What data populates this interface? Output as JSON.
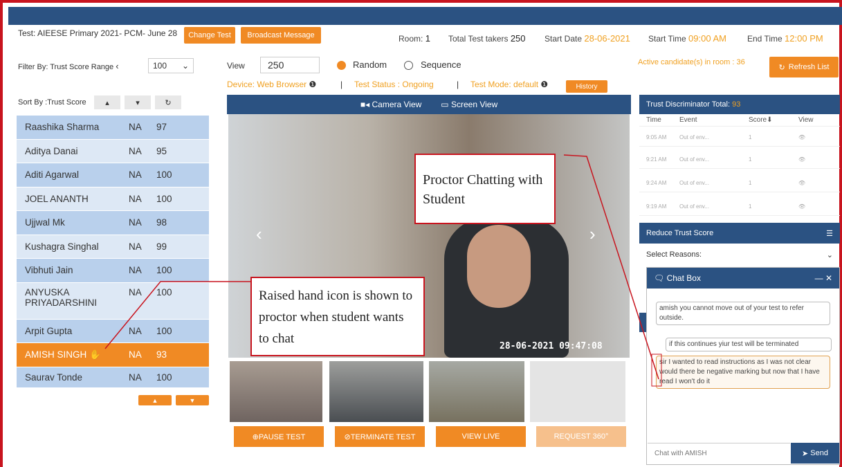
{
  "header": {
    "test_label": "Test:",
    "test_name": "AIEESE Primary 2021- PCM- June 28",
    "change_test": "Change Test",
    "broadcast": "Broadcast Message",
    "room_label": "Room:",
    "room_value": "1",
    "total_label": "Total Test takers",
    "total_value": "250",
    "start_date_label": "Start Date",
    "start_date_value": "28-06-2021",
    "start_time_label": "Start Time",
    "start_time_value": "09:00 AM",
    "end_time_label": "End Time",
    "end_time_value": "12:00 PM"
  },
  "filter": {
    "label": "Filter By: Trust Score Range",
    "range_value": "100",
    "view_label": "View",
    "view_value": "250",
    "random_label": "Random",
    "sequence_label": "Sequence",
    "active_candidates": "Active candidate(s) in room : 36",
    "refresh": "Refresh List"
  },
  "status": {
    "device": "Device: Web Browser",
    "test_status": "Test Status : Ongoing",
    "test_mode": "Test Mode: default",
    "history": "History"
  },
  "sort": {
    "label": "Sort By :Trust Score"
  },
  "candidates": [
    {
      "name": "Raashika Sharma",
      "na": "NA",
      "score": "97"
    },
    {
      "name": "Aditya Danai",
      "na": "NA",
      "score": "95"
    },
    {
      "name": "Aditi Agarwal",
      "na": "NA",
      "score": "100"
    },
    {
      "name": "JOEL ANANTH",
      "na": "NA",
      "score": "100"
    },
    {
      "name": "Ujjwal Mk",
      "na": "NA",
      "score": "98"
    },
    {
      "name": "Kushagra Singhal",
      "na": "NA",
      "score": "99"
    },
    {
      "name": "Vibhuti Jain",
      "na": "NA",
      "score": "100"
    },
    {
      "name": "ANYUSKA PRIYADARSHINI",
      "na": "NA",
      "score": "100"
    },
    {
      "name": "Arpit Gupta",
      "na": "NA",
      "score": "100"
    },
    {
      "name": "AMISH SINGH",
      "na": "NA",
      "score": "93"
    },
    {
      "name": "Saurav Tonde",
      "na": "NA",
      "score": "100"
    }
  ],
  "video": {
    "camera_view": "Camera View",
    "screen_view": "Screen View",
    "timestamp": "28-06-2021 09:47:08"
  },
  "actions": {
    "pause": "⊕PAUSE TEST",
    "terminate": "⊘TERMINATE TEST",
    "view_live": "VIEW LIVE",
    "request": "REQUEST 360°"
  },
  "trust": {
    "title": "Trust Discriminator Total:",
    "total": "93",
    "col_time": "Time",
    "col_event": "Event",
    "col_score": "Score",
    "col_view": "View",
    "rows": [
      {
        "time": "9:05 AM",
        "event": "Out of env...",
        "score": "1"
      },
      {
        "time": "9:21 AM",
        "event": "Out of env...",
        "score": "1"
      },
      {
        "time": "9:24 AM",
        "event": "Out of env...",
        "score": "1"
      },
      {
        "time": "9:19 AM",
        "event": "Out of env...",
        "score": "1"
      }
    ],
    "reduce_title": "Reduce Trust Score",
    "select_reasons": "Select Reasons:"
  },
  "chat": {
    "title": "Chat Box",
    "messages": [
      "amish you cannot move out of your test to refer outside.",
      "if this continues yiur test will be terminated",
      "sir I wanted to read instructions as I was not clear would there be negative marking but now that I have read I won't do it"
    ],
    "input_placeholder": "Chat with AMISH",
    "send": "Send"
  },
  "callouts": {
    "chat_note": "Proctor Chatting with Student",
    "hand_note": "Raised hand icon is shown to proctor when student wants to chat"
  },
  "colors": {
    "brand_blue": "#2b5282",
    "accent_orange": "#f08a24",
    "callout_red": "#c8141e"
  }
}
